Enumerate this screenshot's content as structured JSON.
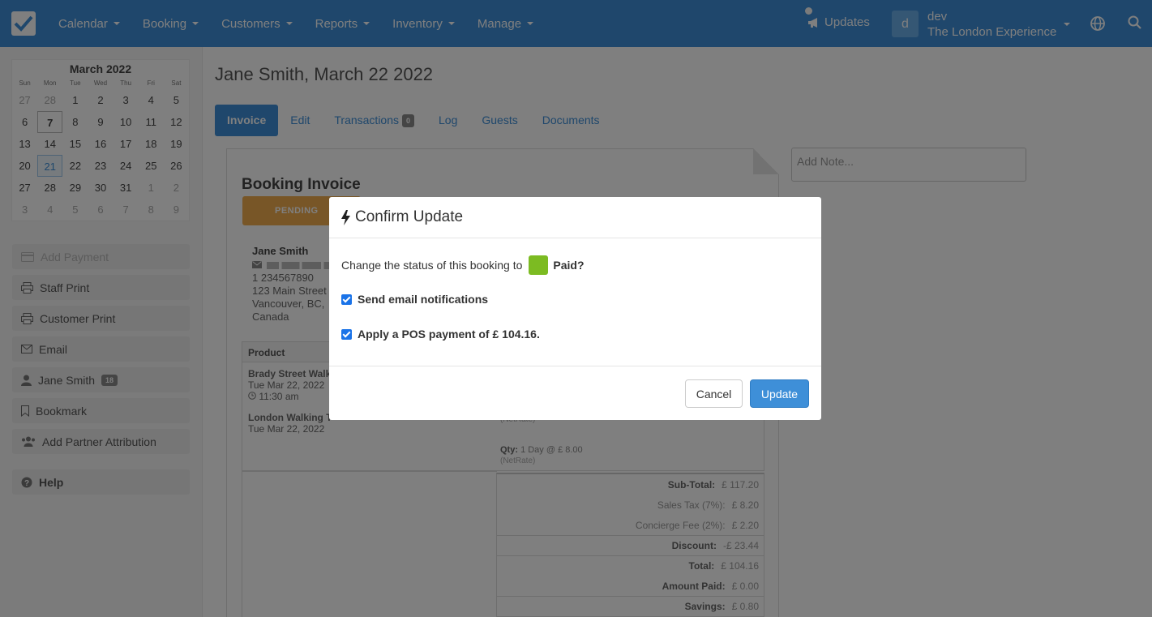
{
  "nav": {
    "menu": [
      {
        "label": "Calendar"
      },
      {
        "label": "Booking"
      },
      {
        "label": "Customers"
      },
      {
        "label": "Reports"
      },
      {
        "label": "Inventory"
      },
      {
        "label": "Manage"
      }
    ],
    "updates_label": "Updates",
    "avatar_letter": "d",
    "user_name": "dev",
    "company": "The London Experience"
  },
  "calendar": {
    "month": "March 2022",
    "dow": [
      "Sun",
      "Mon",
      "Tue",
      "Wed",
      "Thu",
      "Fri",
      "Sat"
    ],
    "days": [
      "27",
      "28",
      "1",
      "2",
      "3",
      "4",
      "5",
      "6",
      "7",
      "8",
      "9",
      "10",
      "11",
      "12",
      "13",
      "14",
      "15",
      "16",
      "17",
      "18",
      "19",
      "20",
      "21",
      "22",
      "23",
      "24",
      "25",
      "26",
      "27",
      "28",
      "29",
      "30",
      "31",
      "1",
      "2",
      "3",
      "4",
      "5",
      "6",
      "7",
      "8",
      "9"
    ]
  },
  "sidebar": {
    "add_payment": "Add Payment",
    "staff_print": "Staff Print",
    "customer_print": "Customer Print",
    "email": "Email",
    "customer_name": "Jane Smith",
    "customer_badge": "18",
    "bookmark": "Bookmark",
    "partner": "Add Partner Attribution",
    "help": "Help"
  },
  "page": {
    "title": "Jane Smith, March 22 2022",
    "tabs": [
      {
        "label": "Invoice"
      },
      {
        "label": "Edit"
      },
      {
        "label": "Transactions",
        "count": "0"
      },
      {
        "label": "Log"
      },
      {
        "label": "Guests"
      },
      {
        "label": "Documents"
      }
    ],
    "note_placeholder": "Add Note..."
  },
  "invoice": {
    "title": "Booking Invoice",
    "status": "PENDING",
    "customer": {
      "name": "Jane Smith",
      "phone": "1 234567890",
      "address1": "123 Main Street",
      "address2": "Vancouver, BC,",
      "country": "Canada"
    },
    "product_header": "Product",
    "products": [
      {
        "name": "Brady Street Walk",
        "date": "Tue Mar 22, 2022",
        "time": "11:30 am"
      },
      {
        "name": "London Walking T",
        "date": "Tue Mar 22, 2022"
      }
    ],
    "qty1_note": "(NetRate)",
    "qty2_label": "Qty:",
    "qty2_value": "1 Day @ £ 8.00",
    "qty2_note": "(NetRate)",
    "totals": [
      {
        "label": "Sub-Total:",
        "value": "£ 117.20"
      },
      {
        "label": "Sales Tax (7%):",
        "value": "£ 8.20"
      },
      {
        "label": "Concierge Fee (2%):",
        "value": "£ 2.20"
      },
      {
        "label": "Discount:",
        "value": "-£ 23.44"
      },
      {
        "label": "Total:",
        "value": "£ 104.16"
      },
      {
        "label": "Amount Paid:",
        "value": "£ 0.00"
      },
      {
        "label": "Savings:",
        "value": "£ 0.80"
      }
    ]
  },
  "modal": {
    "title": "Confirm Update",
    "question": "Change the status of this booking to",
    "new_status": "Paid?",
    "status_color": "#7cbb22",
    "check_email": "Send email notifications",
    "check_pos": "Apply a POS payment of £ 104.16.",
    "cancel": "Cancel",
    "update": "Update"
  }
}
